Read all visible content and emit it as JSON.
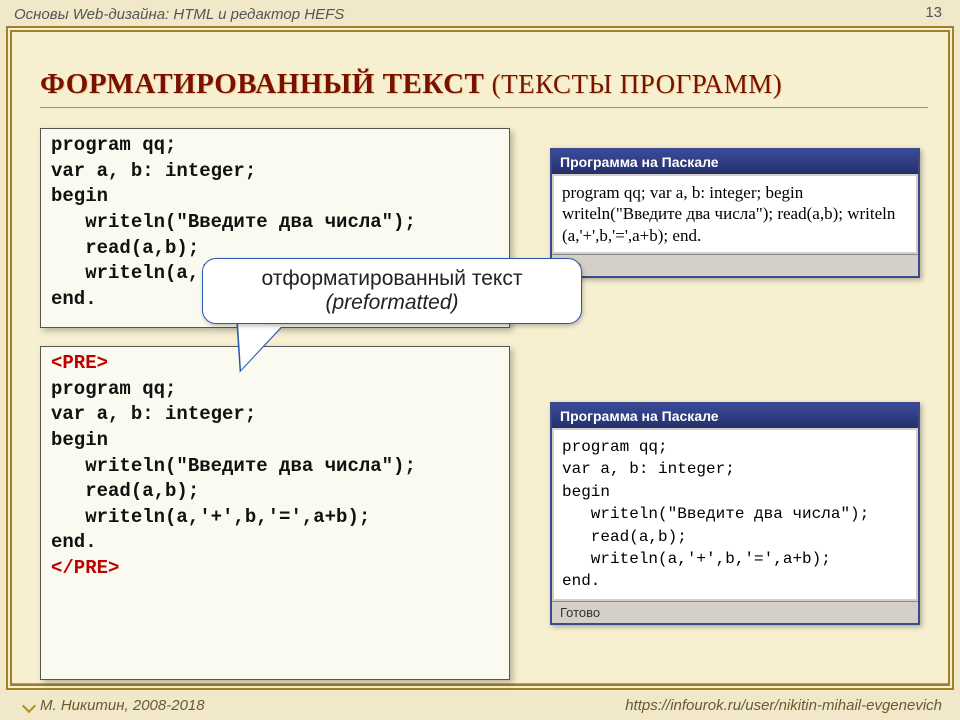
{
  "header": {
    "breadcrumb": "Основы Web-дизайна: HTML и редактор HEFS",
    "page_number": "13"
  },
  "title": {
    "main": "ФОРМАТИРОВАННЫЙ ТЕКСТ",
    "subtitle": " (ТЕКСТЫ ПРОГРАММ)"
  },
  "code1": "program qq;\nvar a, b: integer;\nbegin\n   writeln(\"Введите два числа\");\n   read(a,b);\n   writeln(a,'+',b,'=',a+b);\nend.",
  "code2_open": "<PRE>",
  "code2_body": "program qq;\nvar a, b: integer;\nbegin\n   writeln(\"Введите два числа\");\n   read(a,b);\n   writeln(a,'+',b,'=',a+b);\nend.",
  "code2_close": "</PRE>",
  "callout": {
    "line1": "отформатированный текст",
    "line2": "(preformatted)"
  },
  "windows": {
    "w1": {
      "title": "Программа на Паскале",
      "body": "program qq; var a, b: integer; begin writeln(\"Введите два числа\"); read(a,b); writeln (a,'+',b,'=',a+b); end.",
      "status": "ово"
    },
    "w2": {
      "title": "Программа на Паскале",
      "body": "program qq;\nvar a, b: integer;\nbegin\n   writeln(\"Введите два числа\");\n   read(a,b);\n   writeln(a,'+',b,'=',a+b);\nend.",
      "status": "Готово"
    }
  },
  "footer": {
    "author": "М. Никитин, 2008-2018",
    "url": "https://infourok.ru/user/nikitin-mihail-evgenevich"
  }
}
